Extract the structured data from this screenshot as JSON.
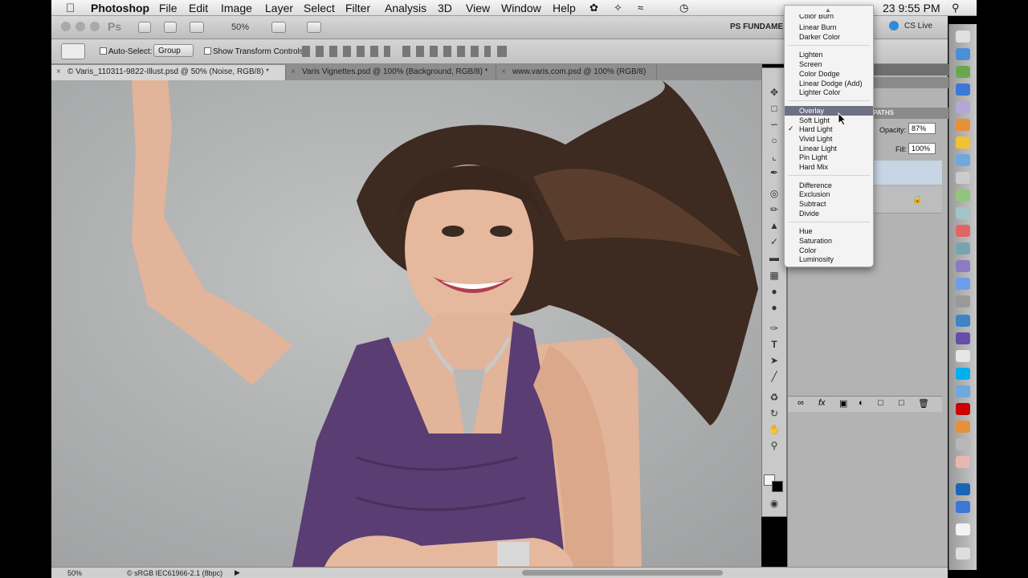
{
  "menubar": {
    "app": "Photoshop",
    "items": [
      "File",
      "Edit",
      "Image",
      "Layer",
      "Select",
      "Filter",
      "Analysis",
      "3D",
      "View",
      "Window",
      "Help"
    ],
    "clock": "23  9:55 PM"
  },
  "appbar": {
    "zoom": "50%",
    "workspace": "PS FUNDAME",
    "cslive": "CS Live"
  },
  "optbar": {
    "auto_select_label": "Auto-Select:",
    "auto_select_value": "Group",
    "transform_label": "Show Transform Controls"
  },
  "tabs": [
    {
      "label": "© Varis_110311-9822-Illust.psd @ 50% (Noise, RGB/8) *"
    },
    {
      "label": "Varis Vignettes.psd @ 100% (Background, RGB/8) *"
    },
    {
      "label": "www.varis.com.psd @ 100% (RGB/8)"
    }
  ],
  "layers_panel": {
    "tab": "PATHS",
    "opacity_label": "Opacity:",
    "opacity_value": "87%",
    "fill_label": "Fill:",
    "fill_value": "100%"
  },
  "blend_menu": {
    "items": [
      "Color Burn",
      "Linear Burn",
      "Darker Color",
      "Lighten",
      "Screen",
      "Color Dodge",
      "Linear Dodge (Add)",
      "Lighter Color",
      "Overlay",
      "Soft Light",
      "Hard Light",
      "Vivid Light",
      "Linear Light",
      "Pin Light",
      "Hard Mix",
      "Difference",
      "Exclusion",
      "Subtract",
      "Divide",
      "Hue",
      "Saturation",
      "Color",
      "Luminosity"
    ],
    "highlighted": "Overlay",
    "checked": "Hard Light",
    "check_mark": "✓"
  },
  "status": {
    "zoom": "50%",
    "profile": "© sRGB IEC61966-2.1 (8bpc)"
  },
  "colors": {
    "highlight": "#6e7184",
    "dress": "#5a3d72",
    "background": "#aeb0b1"
  }
}
